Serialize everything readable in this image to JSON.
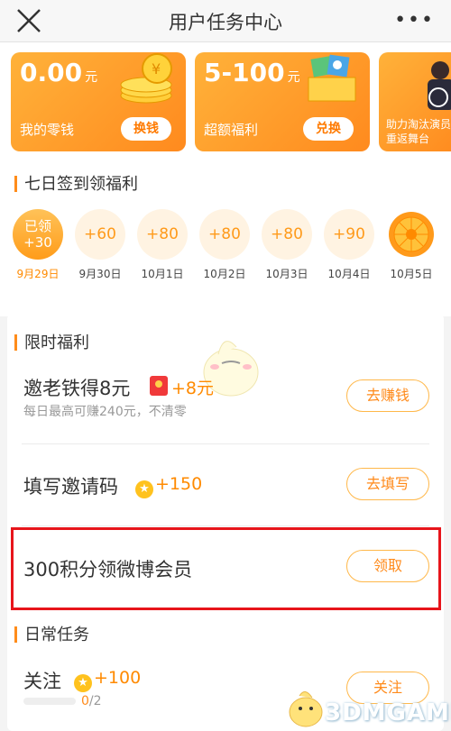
{
  "header": {
    "title": "用户任务中心",
    "more": "•••"
  },
  "cards": [
    {
      "amount": "0.00",
      "unit": "元",
      "label": "我的零钱",
      "button": "换钱"
    },
    {
      "amount": "5-100",
      "unit": "元",
      "label": "超额福利",
      "button": "兑换"
    },
    {
      "label": "助力淘汰演员重返舞台"
    }
  ],
  "checkin": {
    "title": "七日签到领福利",
    "days": [
      {
        "top": "已领",
        "value": "+30",
        "date": "9月29日"
      },
      {
        "value": "+60",
        "date": "9月30日"
      },
      {
        "value": "+80",
        "date": "10月1日"
      },
      {
        "value": "+80",
        "date": "10月2日"
      },
      {
        "value": "+80",
        "date": "10月3日"
      },
      {
        "value": "+90",
        "date": "10月4日"
      },
      {
        "value": "",
        "date": "10月5日"
      }
    ]
  },
  "limited": {
    "title": "限时福利",
    "tasks": [
      {
        "title": "邀老铁得8元",
        "reward": "+8元",
        "subtitle": "每日最高可赚240元，不清零",
        "button": "去赚钱"
      },
      {
        "title": "填写邀请码",
        "reward": "+150",
        "button": "去填写"
      },
      {
        "title": "300积分领微博会员",
        "button": "领取"
      }
    ]
  },
  "daily": {
    "title": "日常任务",
    "tasks": [
      {
        "title": "关注",
        "reward": "+100",
        "progress_done": "0",
        "progress_total": "/2",
        "progress": 0,
        "button": "关注"
      }
    ]
  },
  "watermark": "3DMGAME",
  "colors": {
    "accent": "#ff8a1a",
    "highlight_box": "#e7151b"
  }
}
